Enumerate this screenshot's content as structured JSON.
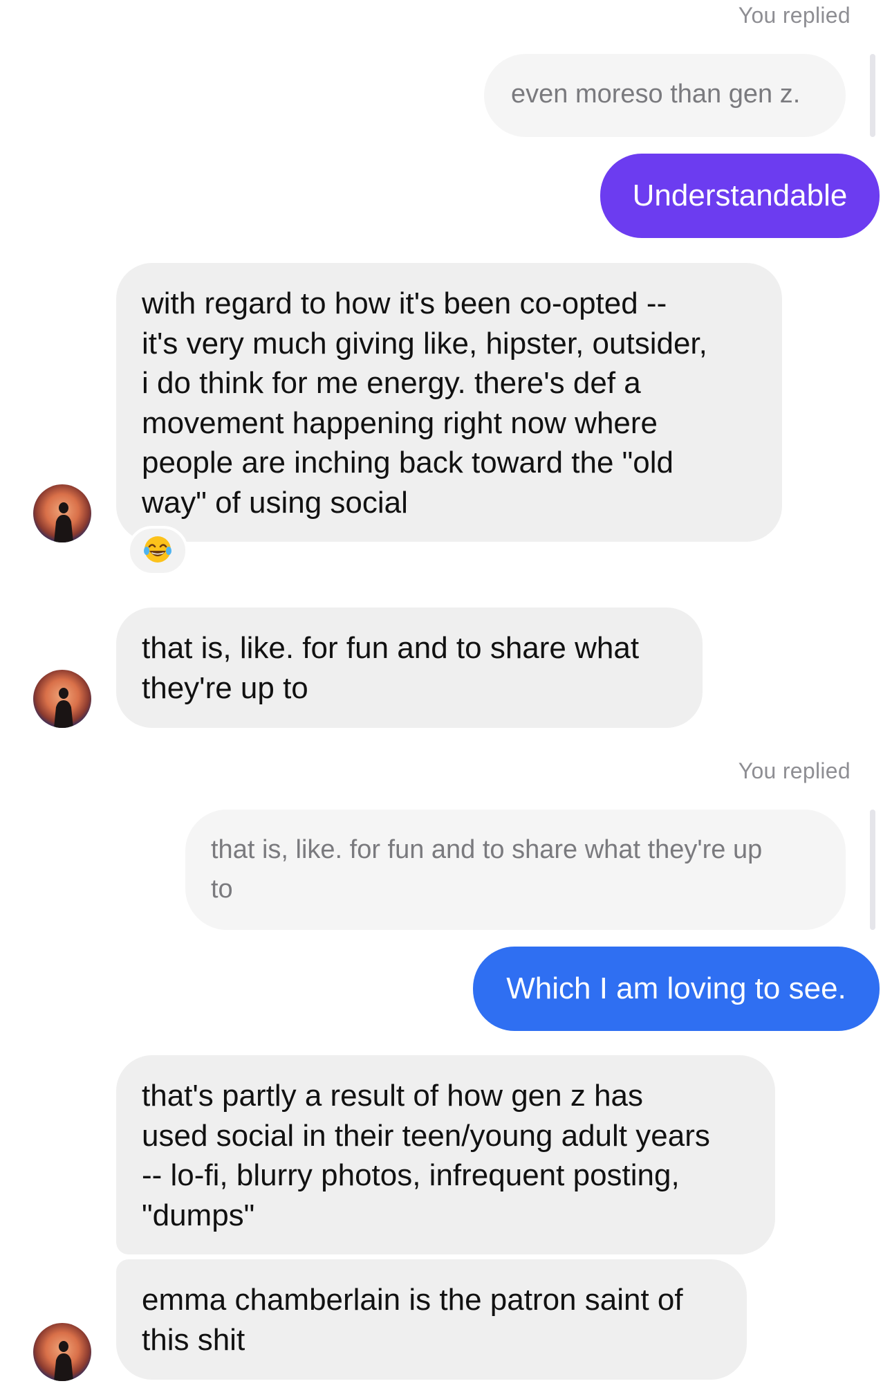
{
  "thread": {
    "reply_label_1": "You replied",
    "quote_1": "even moreso than gen z.",
    "sent_1": "Understandable",
    "received_1": "with regard to how it's been co-opted --\nit's very much giving like, hipster, outsider,\ni do think for me energy. there's def a\nmovement happening right now where\npeople are inching back toward the \"old\nway\" of using social",
    "reaction_1_emoji": "face-with-tears-of-joy-icon",
    "received_2": "that is, like. for fun and to share what\nthey're up to",
    "reply_label_2": "You replied",
    "quote_2": "that is, like. for fun and to share what they're up\nto",
    "sent_2": "Which I am loving to see.",
    "received_3": "that's partly a result of how gen z has\nused social in their teen/young adult years\n-- lo-fi, blurry photos, infrequent posting,\n\"dumps\"",
    "received_4": "emma chamberlain is the patron saint of\nthis shit"
  },
  "colors": {
    "sent_purple": "#6c3cf0",
    "sent_blue": "#2f6ff2",
    "received_bg": "#efefef",
    "quote_bg": "#f5f5f5"
  }
}
